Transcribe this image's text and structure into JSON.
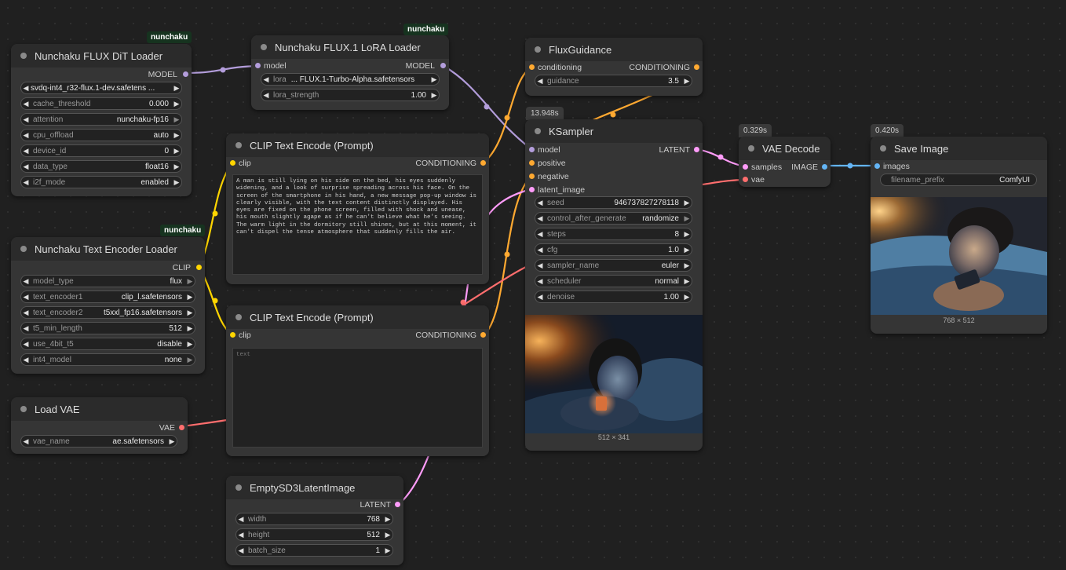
{
  "colors": {
    "background": "#202020",
    "model": "#b39ddb",
    "clip": "#ffd500",
    "conditioning": "#ffa931",
    "latent": "#ff9cf9",
    "vae": "#ff6e6e",
    "image": "#64b5f6"
  },
  "badges": {
    "nunchaku_dit": "nunchaku",
    "nunchaku_lora": "nunchaku",
    "nunchaku_te": "nunchaku"
  },
  "timings": {
    "ksampler": "13.948s",
    "vae_decode": "0.329s",
    "save_image": "0.420s"
  },
  "dit_loader": {
    "title": "Nunchaku FLUX DiT Loader",
    "output": "MODEL",
    "model_path": "svdq-int4_r32-flux.1-dev.safetens ...",
    "widgets": [
      {
        "label": "cache_threshold",
        "value": "0.000"
      },
      {
        "label": "attention",
        "value": "nunchaku-fp16"
      },
      {
        "label": "cpu_offload",
        "value": "auto"
      },
      {
        "label": "device_id",
        "value": "0"
      },
      {
        "label": "data_type",
        "value": "float16"
      },
      {
        "label": "i2f_mode",
        "value": "enabled"
      }
    ]
  },
  "lora_loader": {
    "title": "Nunchaku FLUX.1 LoRA Loader",
    "input": "model",
    "output": "MODEL",
    "lora_label": "lora",
    "lora_value": "... FLUX.1-Turbo-Alpha.safetensors",
    "strength_label": "lora_strength",
    "strength_value": "1.00"
  },
  "text_encoder_loader": {
    "title": "Nunchaku Text Encoder Loader",
    "output": "CLIP",
    "widgets": [
      {
        "label": "model_type",
        "value": "flux"
      },
      {
        "label": "text_encoder1",
        "value": "clip_l.safetensors"
      },
      {
        "label": "text_encoder2",
        "value": "t5xxl_fp16.safetensors"
      },
      {
        "label": "t5_min_length",
        "value": "512"
      },
      {
        "label": "use_4bit_t5",
        "value": "disable"
      },
      {
        "label": "int4_model",
        "value": "none"
      }
    ]
  },
  "load_vae": {
    "title": "Load VAE",
    "output": "VAE",
    "widget_label": "vae_name",
    "widget_value": "ae.safetensors"
  },
  "clip_encode_pos": {
    "title": "CLIP Text Encode (Prompt)",
    "input": "clip",
    "output": "CONDITIONING",
    "text": "A man is still lying on his side on the bed, his eyes suddenly widening, and a look of surprise spreading across his face. On the screen of the smartphone in his hand, a new message pop-up window is clearly visible, with the text content distinctly displayed. His eyes are fixed on the phone screen, filled with shock and unease, his mouth slightly agape as if he can't believe what he's seeing. The warm light in the dormitory still shines, but at this moment, it can't dispel the tense atmosphere that suddenly fills the air."
  },
  "clip_encode_neg": {
    "title": "CLIP Text Encode (Prompt)",
    "input": "clip",
    "output": "CONDITIONING",
    "placeholder": "text"
  },
  "empty_latent": {
    "title": "EmptySD3LatentImage",
    "output": "LATENT",
    "widgets": [
      {
        "label": "width",
        "value": "768"
      },
      {
        "label": "height",
        "value": "512"
      },
      {
        "label": "batch_size",
        "value": "1"
      }
    ]
  },
  "flux_guidance": {
    "title": "FluxGuidance",
    "input": "conditioning",
    "output": "CONDITIONING",
    "widget_label": "guidance",
    "widget_value": "3.5"
  },
  "ksampler": {
    "title": "KSampler",
    "inputs": [
      "model",
      "positive",
      "negative",
      "latent_image"
    ],
    "output": "LATENT",
    "widgets": [
      {
        "label": "seed",
        "value": "946737827278118"
      },
      {
        "label": "control_after_generate",
        "value": "randomize"
      },
      {
        "label": "steps",
        "value": "8"
      },
      {
        "label": "cfg",
        "value": "1.0"
      },
      {
        "label": "sampler_name",
        "value": "euler"
      },
      {
        "label": "scheduler",
        "value": "normal"
      },
      {
        "label": "denoise",
        "value": "1.00"
      }
    ],
    "preview_size": "512 × 341"
  },
  "vae_decode": {
    "title": "VAE Decode",
    "inputs": [
      "samples",
      "vae"
    ],
    "output": "IMAGE"
  },
  "save_image": {
    "title": "Save Image",
    "input": "images",
    "widget_label": "filename_prefix",
    "widget_value": "ComfyUI",
    "preview_size": "768 × 512"
  }
}
